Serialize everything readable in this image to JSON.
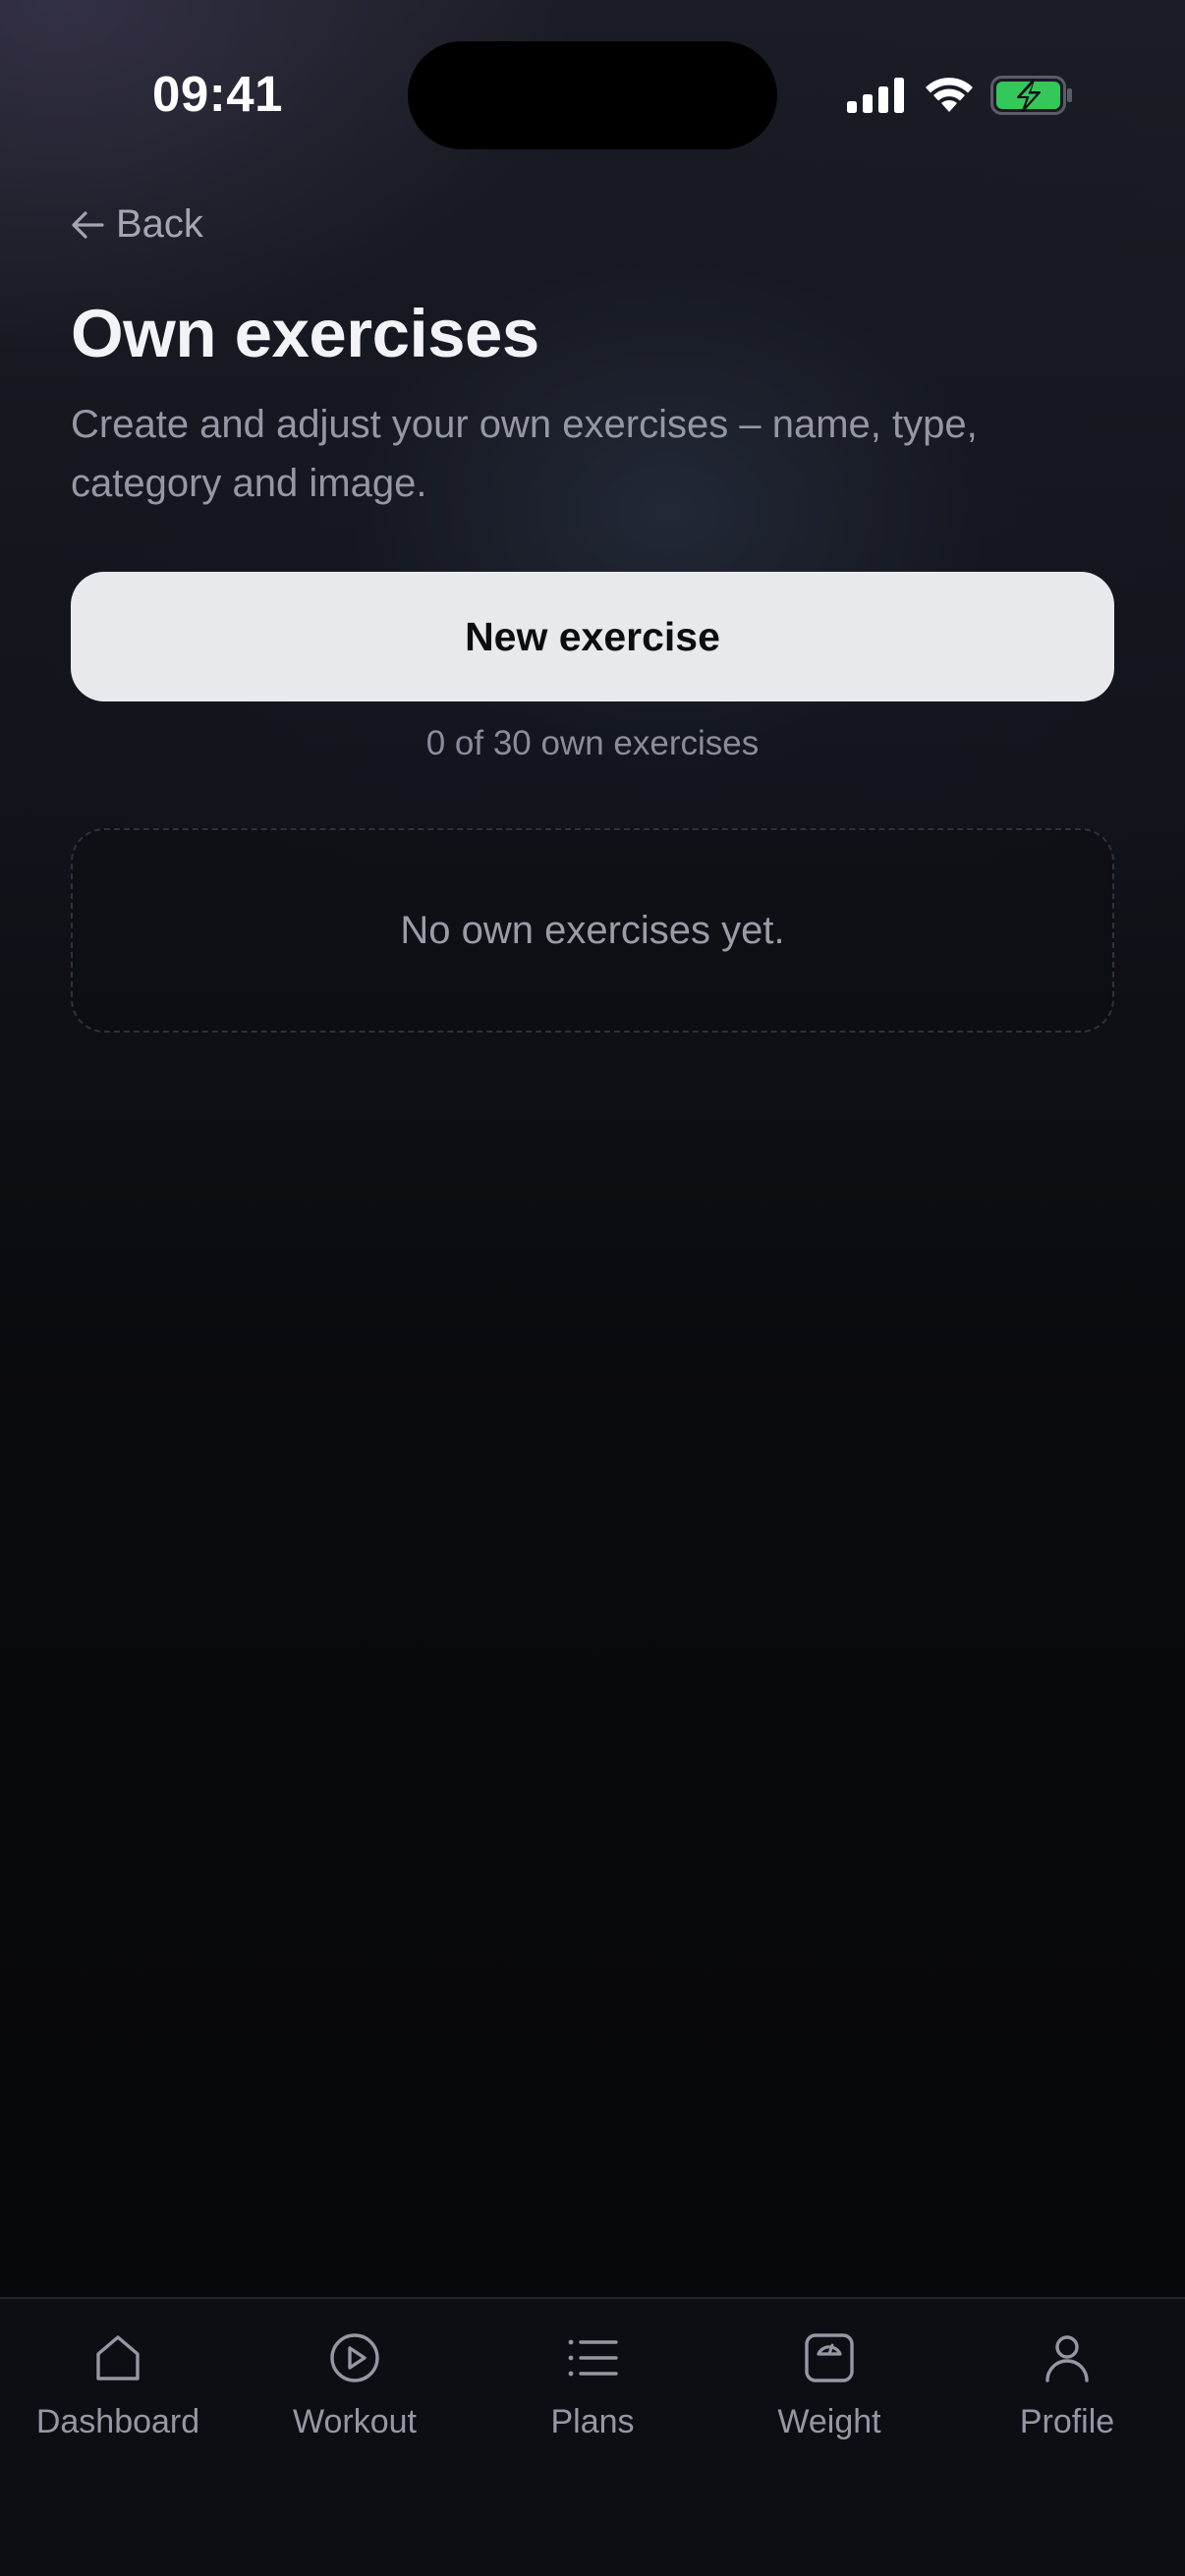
{
  "status_bar": {
    "time": "09:41",
    "icons": [
      "cellular-signal-icon",
      "wifi-icon",
      "battery-charging-icon"
    ],
    "battery_color": "#34c759"
  },
  "header": {
    "back_label": "Back",
    "title": "Own exercises",
    "subtitle": "Create and adjust your own exercises – name, type, category and image."
  },
  "actions": {
    "new_exercise_label": "New exercise"
  },
  "exercise_count_text": "0 of 30 own exercises",
  "empty_state": {
    "message": "No own exercises yet."
  },
  "bottom_nav": {
    "items": [
      {
        "label": "Dashboard",
        "icon": "home-icon"
      },
      {
        "label": "Workout",
        "icon": "play-circle-icon"
      },
      {
        "label": "Plans",
        "icon": "list-icon"
      },
      {
        "label": "Weight",
        "icon": "scale-icon"
      },
      {
        "label": "Profile",
        "icon": "user-icon"
      }
    ]
  },
  "colors": {
    "background": "#07080b",
    "primary_button": "#e8e9ed",
    "text_primary": "#f2f3f6",
    "text_secondary": "#9598a4"
  }
}
